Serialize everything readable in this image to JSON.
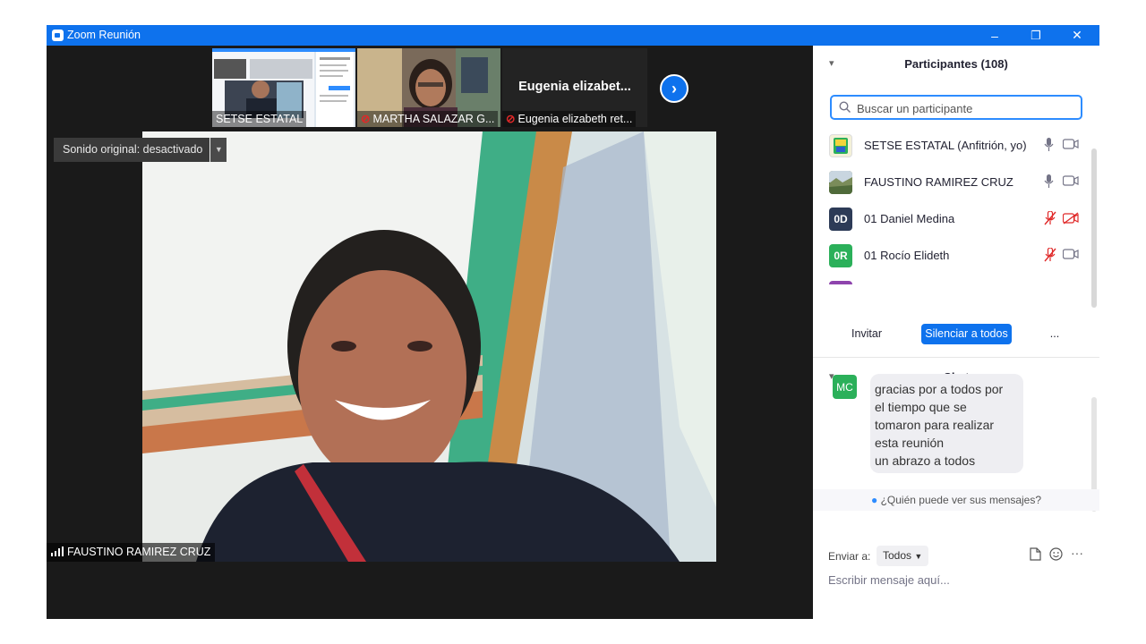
{
  "window": {
    "title": "Zoom Reunión",
    "controls": {
      "minimize": "–",
      "restore": "❐",
      "close": "✕"
    }
  },
  "gallery": {
    "thumbnails": [
      {
        "name": "SETSE ESTATAL",
        "muted": false
      },
      {
        "name": "MARTHA SALAZAR G...",
        "muted": true
      },
      {
        "name": "Eugenia elizabeth ret...",
        "muted": true,
        "big_label": "Eugenia  elizabet..."
      }
    ],
    "next_icon": "chevron-right-icon"
  },
  "main_video": {
    "sound_label": "Sonido original: desactivado",
    "speaker_name": "FAUSTINO RAMIREZ CRUZ"
  },
  "participants": {
    "title": "Participantes (108)",
    "search_placeholder": "Buscar un participante",
    "list": [
      {
        "name": "SETSE ESTATAL (Anfitrión, yo)",
        "avatar": "logo",
        "mic_muted": false,
        "video_off": false
      },
      {
        "name": "FAUSTINO RAMIREZ CRUZ",
        "avatar": "photo",
        "mic_muted": false,
        "video_off": false
      },
      {
        "name": "01 Daniel Medina",
        "initials": "0D",
        "avatar_color": "#2d3b57",
        "mic_muted": true,
        "video_off": true
      },
      {
        "name": "01 Rocío Elideth",
        "initials": "0R",
        "avatar_color": "#2bb05a",
        "mic_muted": true,
        "video_off": false
      }
    ],
    "buttons": {
      "invite": "Invitar",
      "mute_all": "Silenciar a todos",
      "more": "..."
    }
  },
  "chat": {
    "title": "Chat",
    "messages": [
      {
        "initials": "MC",
        "text": "gracias por a todos por\nel tiempo que se\ntomaron para realizar\nesta reunión\nun abrazo a todos"
      }
    ],
    "who_can_see": "¿Quién puede ver sus mensajes?",
    "send_to_label": "Enviar a:",
    "send_to_value": "Todos",
    "input_placeholder": "Escribir mensaje aquí...",
    "more": "···"
  },
  "colors": {
    "accent": "#0e72ed",
    "muted_red": "#e02828",
    "green": "#2bb05a"
  }
}
